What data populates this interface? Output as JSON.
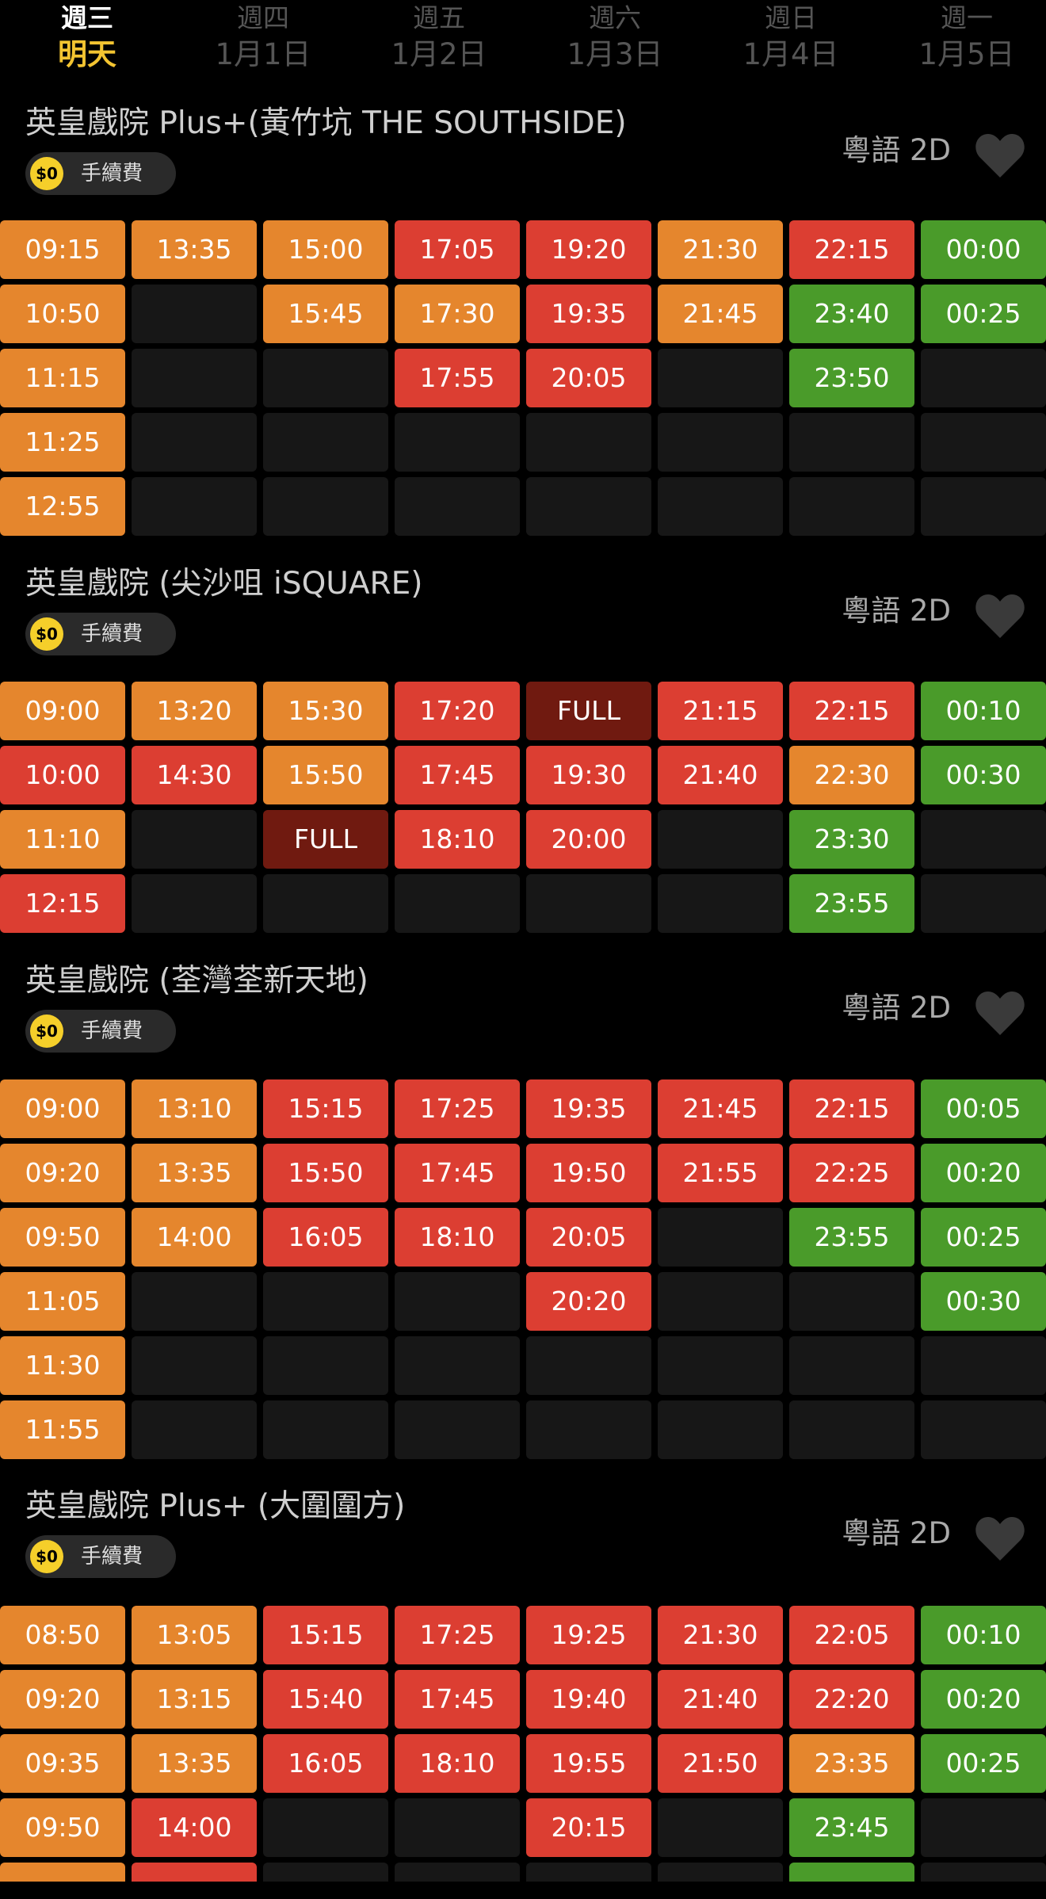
{
  "days": [
    {
      "weekday": "週三",
      "date": "明天",
      "active": true
    },
    {
      "weekday": "週四",
      "date": "1月1日",
      "active": false
    },
    {
      "weekday": "週五",
      "date": "1月2日",
      "active": false
    },
    {
      "weekday": "週六",
      "date": "1月3日",
      "active": false
    },
    {
      "weekday": "週日",
      "date": "1月4日",
      "active": false
    },
    {
      "weekday": "週一",
      "date": "1月5日",
      "active": false
    }
  ],
  "colors": {
    "orange": "#e5862d",
    "red": "#dc3e32",
    "green": "#4a9b2a",
    "full": "#701a10",
    "empty": "#171717",
    "accent": "#f3c431"
  },
  "cinemas": [
    {
      "name": "英皇戲院 Plus+(黃竹坑 THE SOUTHSIDE)",
      "fee_amount": "$0",
      "fee_label": "手續費",
      "format": "粵語 2D",
      "columns": [
        [
          [
            "09:15",
            "o"
          ],
          [
            "10:50",
            "o"
          ],
          [
            "11:15",
            "o"
          ],
          [
            "11:25",
            "o"
          ],
          [
            "12:55",
            "o"
          ]
        ],
        [
          [
            "13:35",
            "o"
          ],
          [
            "",
            "e"
          ],
          [
            "",
            "e"
          ],
          [
            "",
            "e"
          ],
          [
            "",
            "e"
          ]
        ],
        [
          [
            "15:00",
            "o"
          ],
          [
            "15:45",
            "o"
          ],
          [
            "",
            "e"
          ],
          [
            "",
            "e"
          ],
          [
            "",
            "e"
          ]
        ],
        [
          [
            "17:05",
            "r"
          ],
          [
            "17:30",
            "o"
          ],
          [
            "17:55",
            "r"
          ],
          [
            "",
            "e"
          ],
          [
            "",
            "e"
          ]
        ],
        [
          [
            "19:20",
            "r"
          ],
          [
            "19:35",
            "r"
          ],
          [
            "20:05",
            "r"
          ],
          [
            "",
            "e"
          ],
          [
            "",
            "e"
          ]
        ],
        [
          [
            "21:30",
            "o"
          ],
          [
            "21:45",
            "o"
          ],
          [
            "",
            "e"
          ],
          [
            "",
            "e"
          ],
          [
            "",
            "e"
          ]
        ],
        [
          [
            "22:15",
            "r"
          ],
          [
            "23:40",
            "g"
          ],
          [
            "23:50",
            "g"
          ],
          [
            "",
            "e"
          ],
          [
            "",
            "e"
          ]
        ],
        [
          [
            "00:00",
            "g"
          ],
          [
            "00:25",
            "g"
          ],
          [
            "",
            "e"
          ],
          [
            "",
            "e"
          ],
          [
            "",
            "e"
          ]
        ]
      ]
    },
    {
      "name": "英皇戲院 (尖沙咀 iSQUARE)",
      "fee_amount": "$0",
      "fee_label": "手續費",
      "format": "粵語 2D",
      "columns": [
        [
          [
            "09:00",
            "o"
          ],
          [
            "10:00",
            "r"
          ],
          [
            "11:10",
            "o"
          ],
          [
            "12:15",
            "r"
          ]
        ],
        [
          [
            "13:20",
            "o"
          ],
          [
            "14:30",
            "r"
          ],
          [
            "",
            "e"
          ],
          [
            "",
            "e"
          ]
        ],
        [
          [
            "15:30",
            "o"
          ],
          [
            "15:50",
            "o"
          ],
          [
            "FULL",
            "f"
          ],
          [
            "",
            "e"
          ]
        ],
        [
          [
            "17:20",
            "r"
          ],
          [
            "17:45",
            "r"
          ],
          [
            "18:10",
            "r"
          ],
          [
            "",
            "e"
          ]
        ],
        [
          [
            "FULL",
            "f"
          ],
          [
            "19:30",
            "r"
          ],
          [
            "20:00",
            "r"
          ],
          [
            "",
            "e"
          ]
        ],
        [
          [
            "21:15",
            "r"
          ],
          [
            "21:40",
            "r"
          ],
          [
            "",
            "e"
          ],
          [
            "",
            "e"
          ]
        ],
        [
          [
            "22:15",
            "r"
          ],
          [
            "22:30",
            "o"
          ],
          [
            "23:30",
            "g"
          ],
          [
            "23:55",
            "g"
          ]
        ],
        [
          [
            "00:10",
            "g"
          ],
          [
            "00:30",
            "g"
          ],
          [
            "",
            "e"
          ],
          [
            "",
            "e"
          ]
        ]
      ]
    },
    {
      "name": "英皇戲院 (荃灣荃新天地)",
      "fee_amount": "$0",
      "fee_label": "手續費",
      "format": "粵語 2D",
      "columns": [
        [
          [
            "09:00",
            "o"
          ],
          [
            "09:20",
            "o"
          ],
          [
            "09:50",
            "o"
          ],
          [
            "11:05",
            "o"
          ],
          [
            "11:30",
            "o"
          ],
          [
            "11:55",
            "o"
          ]
        ],
        [
          [
            "13:10",
            "o"
          ],
          [
            "13:35",
            "o"
          ],
          [
            "14:00",
            "o"
          ],
          [
            "",
            "e"
          ],
          [
            "",
            "e"
          ],
          [
            "",
            "e"
          ]
        ],
        [
          [
            "15:15",
            "r"
          ],
          [
            "15:50",
            "r"
          ],
          [
            "16:05",
            "r"
          ],
          [
            "",
            "e"
          ],
          [
            "",
            "e"
          ],
          [
            "",
            "e"
          ]
        ],
        [
          [
            "17:25",
            "r"
          ],
          [
            "17:45",
            "r"
          ],
          [
            "18:10",
            "r"
          ],
          [
            "",
            "e"
          ],
          [
            "",
            "e"
          ],
          [
            "",
            "e"
          ]
        ],
        [
          [
            "19:35",
            "r"
          ],
          [
            "19:50",
            "r"
          ],
          [
            "20:05",
            "r"
          ],
          [
            "20:20",
            "r"
          ],
          [
            "",
            "e"
          ],
          [
            "",
            "e"
          ]
        ],
        [
          [
            "21:45",
            "r"
          ],
          [
            "21:55",
            "r"
          ],
          [
            "",
            "e"
          ],
          [
            "",
            "e"
          ],
          [
            "",
            "e"
          ],
          [
            "",
            "e"
          ]
        ],
        [
          [
            "22:15",
            "r"
          ],
          [
            "22:25",
            "r"
          ],
          [
            "23:55",
            "g"
          ],
          [
            "",
            "e"
          ],
          [
            "",
            "e"
          ],
          [
            "",
            "e"
          ]
        ],
        [
          [
            "00:05",
            "g"
          ],
          [
            "00:20",
            "g"
          ],
          [
            "00:25",
            "g"
          ],
          [
            "00:30",
            "g"
          ],
          [
            "",
            "e"
          ],
          [
            "",
            "e"
          ]
        ]
      ]
    },
    {
      "name": "英皇戲院 Plus+ (大圍圍方)",
      "fee_amount": "$0",
      "fee_label": "手續費",
      "format": "粵語 2D",
      "columns": [
        [
          [
            "08:50",
            "o"
          ],
          [
            "09:20",
            "o"
          ],
          [
            "09:35",
            "o"
          ],
          [
            "09:50",
            "o"
          ],
          [
            "",
            "o"
          ]
        ],
        [
          [
            "13:05",
            "o"
          ],
          [
            "13:15",
            "o"
          ],
          [
            "13:35",
            "o"
          ],
          [
            "14:00",
            "r"
          ],
          [
            "",
            "r"
          ]
        ],
        [
          [
            "15:15",
            "r"
          ],
          [
            "15:40",
            "r"
          ],
          [
            "16:05",
            "r"
          ],
          [
            "",
            "e"
          ],
          [
            "",
            "e"
          ]
        ],
        [
          [
            "17:25",
            "r"
          ],
          [
            "17:45",
            "r"
          ],
          [
            "18:10",
            "r"
          ],
          [
            "",
            "e"
          ],
          [
            "",
            "e"
          ]
        ],
        [
          [
            "19:25",
            "r"
          ],
          [
            "19:40",
            "r"
          ],
          [
            "19:55",
            "r"
          ],
          [
            "20:15",
            "r"
          ],
          [
            "",
            "e"
          ]
        ],
        [
          [
            "21:30",
            "r"
          ],
          [
            "21:40",
            "r"
          ],
          [
            "21:50",
            "r"
          ],
          [
            "",
            "e"
          ],
          [
            "",
            "e"
          ]
        ],
        [
          [
            "22:05",
            "r"
          ],
          [
            "22:20",
            "r"
          ],
          [
            "23:35",
            "o"
          ],
          [
            "23:45",
            "g"
          ],
          [
            "",
            "g"
          ]
        ],
        [
          [
            "00:10",
            "g"
          ],
          [
            "00:20",
            "g"
          ],
          [
            "00:25",
            "g"
          ],
          [
            "",
            "e"
          ],
          [
            "",
            "e"
          ]
        ]
      ]
    }
  ]
}
